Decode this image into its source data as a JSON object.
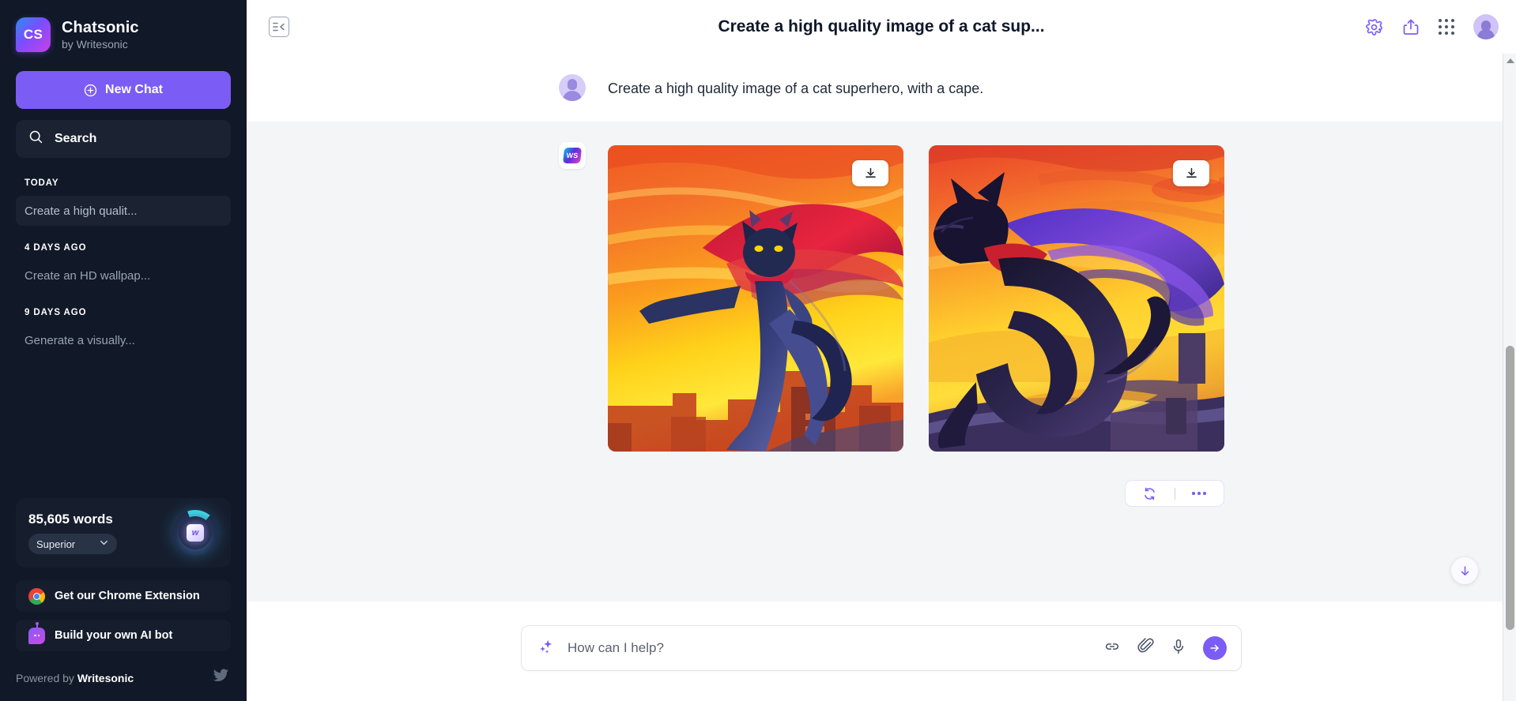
{
  "sidebar": {
    "brand": {
      "logo_text": "CS",
      "title": "Chatsonic",
      "subtitle": "by Writesonic"
    },
    "new_chat_label": "New Chat",
    "search_label": "Search",
    "history_groups": [
      {
        "label": "TODAY",
        "items": [
          {
            "title": "Create a high qualit...",
            "active": true
          }
        ]
      },
      {
        "label": "4 DAYS AGO",
        "items": [
          {
            "title": "Create an HD wallpap...",
            "active": false
          }
        ]
      },
      {
        "label": "9 DAYS AGO",
        "items": [
          {
            "title": "Generate a visually...",
            "active": false
          }
        ]
      }
    ],
    "words_card": {
      "count": "85,605 words",
      "plan": "Superior",
      "chip_letter": "w"
    },
    "promos": [
      {
        "label": "Get our Chrome Extension",
        "icon": "chrome-icon"
      },
      {
        "label": "Build your own AI bot",
        "icon": "robot-icon"
      }
    ],
    "footer": {
      "prefix": "Powered by ",
      "brand": "Writesonic",
      "social_icon": "twitter-icon"
    }
  },
  "header": {
    "collapse_icon": "collapse-sidebar-icon",
    "title": "Create a high quality image of a cat sup...",
    "icons": [
      "gear-icon",
      "share-icon",
      "apps-grid-icon",
      "user-avatar"
    ]
  },
  "conversation": {
    "user_message": {
      "avatar": "user-avatar",
      "text": "Create a high quality image of a cat superhero, with a cape."
    },
    "bot_message": {
      "avatar": "writesonic-logo",
      "avatar_text": "WS",
      "images": [
        {
          "alt": "Cat superhero with red cape leaping over a burning orange city at sunset",
          "download_label": "download-icon"
        },
        {
          "alt": "Black cat superhero with purple cape standing on a rooftop above a golden city",
          "download_label": "download-icon"
        }
      ],
      "actions": [
        {
          "name": "regenerate-button",
          "icon": "refresh-icon"
        },
        {
          "name": "more-options-button",
          "icon": "ellipsis-icon"
        }
      ]
    }
  },
  "composer": {
    "sparkle_icon": "sparkles-icon",
    "placeholder": "How can I help?",
    "value": "",
    "icons": [
      "link-icon",
      "paperclip-icon",
      "microphone-icon"
    ],
    "send_icon": "arrow-right-icon"
  },
  "scroll": {
    "down_button": "scroll-to-bottom-button"
  },
  "colors": {
    "accent": "#7b5cf5",
    "sidebar_bg": "#111827",
    "sidebar_card": "#161e2e",
    "main_bg": "#f4f5f7",
    "text_dark": "#0f172a"
  }
}
